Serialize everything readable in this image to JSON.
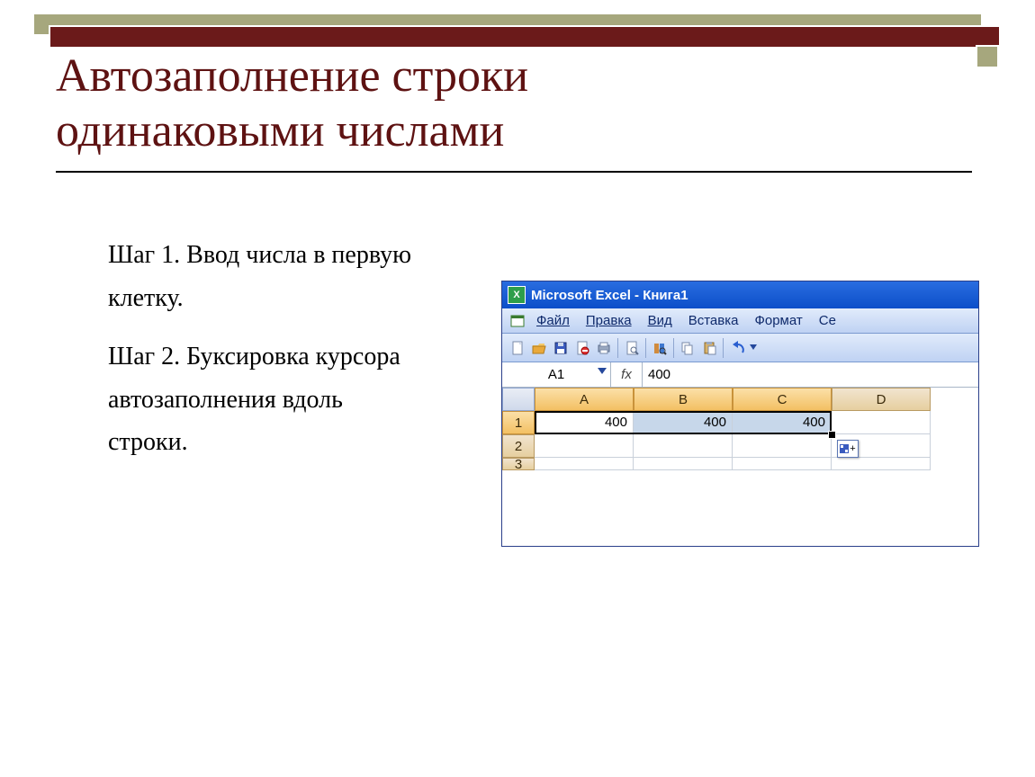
{
  "slide": {
    "title": "Автозаполнение строки одинаковыми числами",
    "steps": [
      "Шаг 1. Ввод числа в первую клетку.",
      "Шаг 2. Буксировка курсора автозаполнения вдоль строки."
    ]
  },
  "excel": {
    "titlebar": "Microsoft Excel - Книга1",
    "menu": {
      "file": "Файл",
      "edit": "Правка",
      "view": "Вид",
      "insert": "Вставка",
      "format": "Формат",
      "service_partial": "Се"
    },
    "namebox": "A1",
    "fx_label": "fx",
    "formula_value": "400",
    "col_headers": [
      "A",
      "B",
      "C",
      "D"
    ],
    "rows": {
      "1": {
        "A": "400",
        "B": "400",
        "C": "400",
        "D": ""
      },
      "2": {
        "A": "",
        "B": "",
        "C": "",
        "D": ""
      },
      "3_partial": {
        "A": "",
        "B": "",
        "C": "",
        "D": ""
      }
    },
    "row_labels": [
      "1",
      "2",
      "3"
    ]
  },
  "colors": {
    "maroon": "#6b1a1a",
    "olive": "#a6a77d",
    "excel_orange": "#f3c063",
    "excel_blue": "#0c4ec9"
  }
}
